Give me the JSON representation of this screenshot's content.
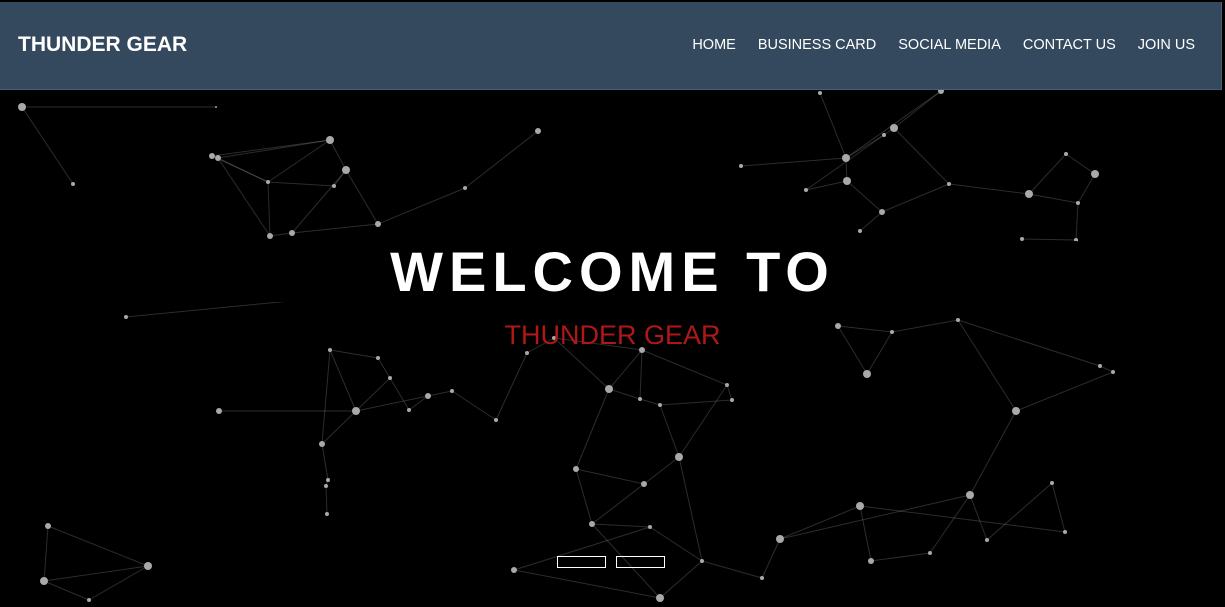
{
  "navbar": {
    "brand": "THUNDER GEAR",
    "links": [
      "HOME",
      "BUSINESS CARD",
      "SOCIAL MEDIA",
      "CONTACT US",
      "JOIN US"
    ]
  },
  "hero": {
    "title": "WELCOME TO",
    "subtitle": "THUNDER GEAR",
    "subtitle_color": "#b01818"
  },
  "carousel": {
    "slide_count": 2
  },
  "colors": {
    "navbar_bg": "#34495e",
    "background": "#000000",
    "text": "#ffffff"
  }
}
